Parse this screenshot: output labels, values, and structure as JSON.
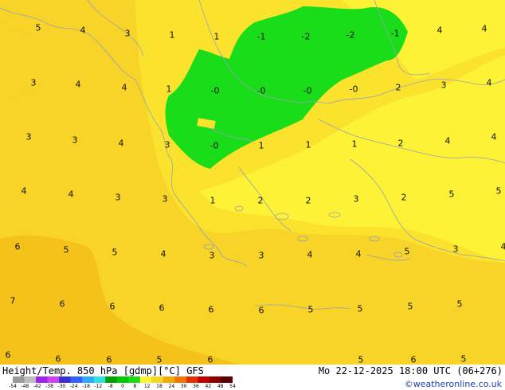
{
  "map": {
    "background_color": "#f8d328",
    "regions": [
      {
        "name": "warm-orange-west",
        "color": "#f5c21a"
      },
      {
        "name": "mid-yellow",
        "color": "#fbe22d"
      },
      {
        "name": "light-yellow",
        "color": "#fdf236"
      },
      {
        "name": "green-cold",
        "color": "#19dd19"
      }
    ],
    "coastline_color": "#9aa0b8",
    "labels": [
      {
        "text": "5"
      },
      {
        "text": "4"
      },
      {
        "text": "3"
      },
      {
        "text": "1"
      },
      {
        "text": "1"
      },
      {
        "text": "-1"
      },
      {
        "text": "-2"
      },
      {
        "text": "-2"
      },
      {
        "text": "-1"
      },
      {
        "text": "4"
      },
      {
        "text": "4"
      },
      {
        "text": "3"
      },
      {
        "text": "4"
      },
      {
        "text": "4"
      },
      {
        "text": "1"
      },
      {
        "text": "-0"
      },
      {
        "text": "-0"
      },
      {
        "text": "-0"
      },
      {
        "text": "-0"
      },
      {
        "text": "2"
      },
      {
        "text": "3"
      },
      {
        "text": "4"
      },
      {
        "text": "3"
      },
      {
        "text": "3"
      },
      {
        "text": "4"
      },
      {
        "text": "3"
      },
      {
        "text": "-0"
      },
      {
        "text": "1"
      },
      {
        "text": "1"
      },
      {
        "text": "1"
      },
      {
        "text": "2"
      },
      {
        "text": "4"
      },
      {
        "text": "4"
      },
      {
        "text": "4"
      },
      {
        "text": "4"
      },
      {
        "text": "3"
      },
      {
        "text": "3"
      },
      {
        "text": "1"
      },
      {
        "text": "2"
      },
      {
        "text": "2"
      },
      {
        "text": "3"
      },
      {
        "text": "2"
      },
      {
        "text": "5"
      },
      {
        "text": "5"
      },
      {
        "text": "6"
      },
      {
        "text": "5"
      },
      {
        "text": "5"
      },
      {
        "text": "4"
      },
      {
        "text": "3"
      },
      {
        "text": "3"
      },
      {
        "text": "4"
      },
      {
        "text": "4"
      },
      {
        "text": "5"
      },
      {
        "text": "3"
      },
      {
        "text": "4"
      },
      {
        "text": "7"
      },
      {
        "text": "6"
      },
      {
        "text": "6"
      },
      {
        "text": "6"
      },
      {
        "text": "6"
      },
      {
        "text": "6"
      },
      {
        "text": "5"
      },
      {
        "text": "5"
      },
      {
        "text": "5"
      },
      {
        "text": "5"
      },
      {
        "text": "6"
      },
      {
        "text": "6"
      },
      {
        "text": "6"
      },
      {
        "text": "5"
      },
      {
        "text": "6"
      },
      {
        "text": "5"
      },
      {
        "text": "6"
      },
      {
        "text": "5"
      }
    ]
  },
  "footer": {
    "title": "Height/Temp. 850 hPa [gdmp][°C] GFS",
    "date": "Mo 22-12-2025 18:00 UTC (06+276)",
    "site": "©weatheronline.co.uk"
  },
  "colorbar": {
    "ticks": [
      "-54",
      "-48",
      "-42",
      "-38",
      "-30",
      "-24",
      "-18",
      "-12",
      "-8",
      "0",
      "8",
      "12",
      "18",
      "24",
      "30",
      "36",
      "42",
      "48",
      "54"
    ],
    "colors": [
      "#9a9a9a",
      "#bdbdbd",
      "#a020f0",
      "#d040f0",
      "#3b2fd0",
      "#3060ff",
      "#30a8ff",
      "#30e0e0",
      "#00a000",
      "#00c800",
      "#19dd19",
      "#fdf236",
      "#f8d328",
      "#f5a800",
      "#f07800",
      "#e03000",
      "#c00000",
      "#8a0000",
      "#5a0000"
    ]
  }
}
